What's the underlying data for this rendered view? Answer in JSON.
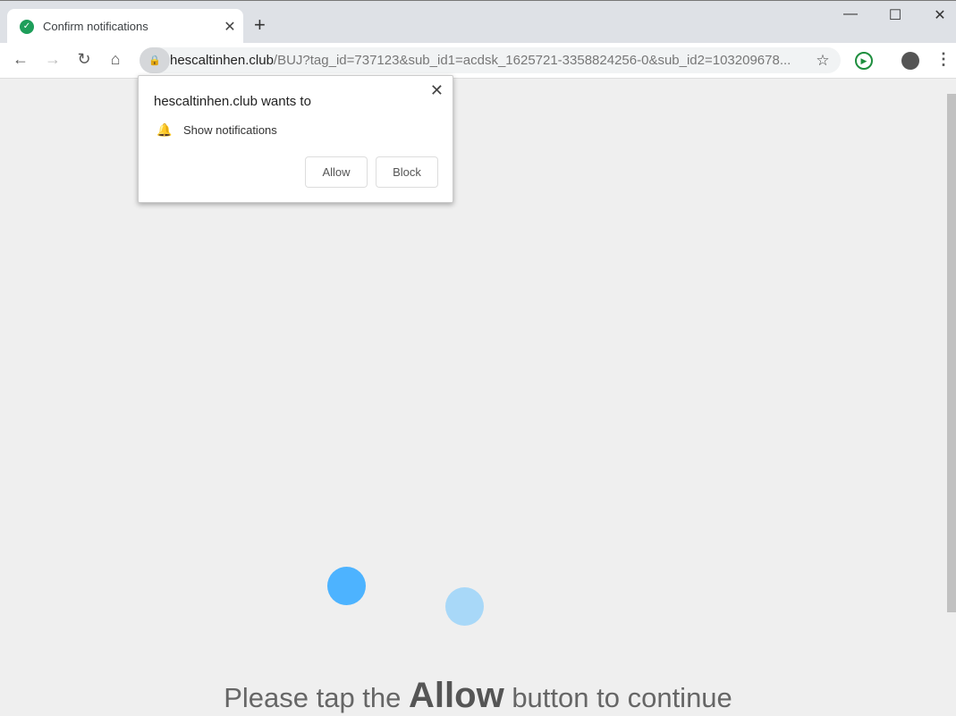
{
  "browser": {
    "tab_title": "Confirm notifications",
    "url_host": "hescaltinhen.club",
    "url_path": "/BUJ?tag_id=737123&sub_id1=acdsk_1625721-3358824256-0&sub_id2=103209678...",
    "icons": {
      "tab_favicon": "check-circle-icon",
      "extension": "play-circle-icon"
    },
    "accent": "#1e9e5a"
  },
  "popup": {
    "title": "hescaltinhen.club wants to",
    "permission": "Show notifications",
    "allow": "Allow",
    "block": "Block"
  },
  "page": {
    "message_before": "Please tap the ",
    "message_bold": "Allow",
    "message_after": " button to continue",
    "dot_colors": [
      "#4db3ff",
      "#a8d8f8"
    ]
  }
}
